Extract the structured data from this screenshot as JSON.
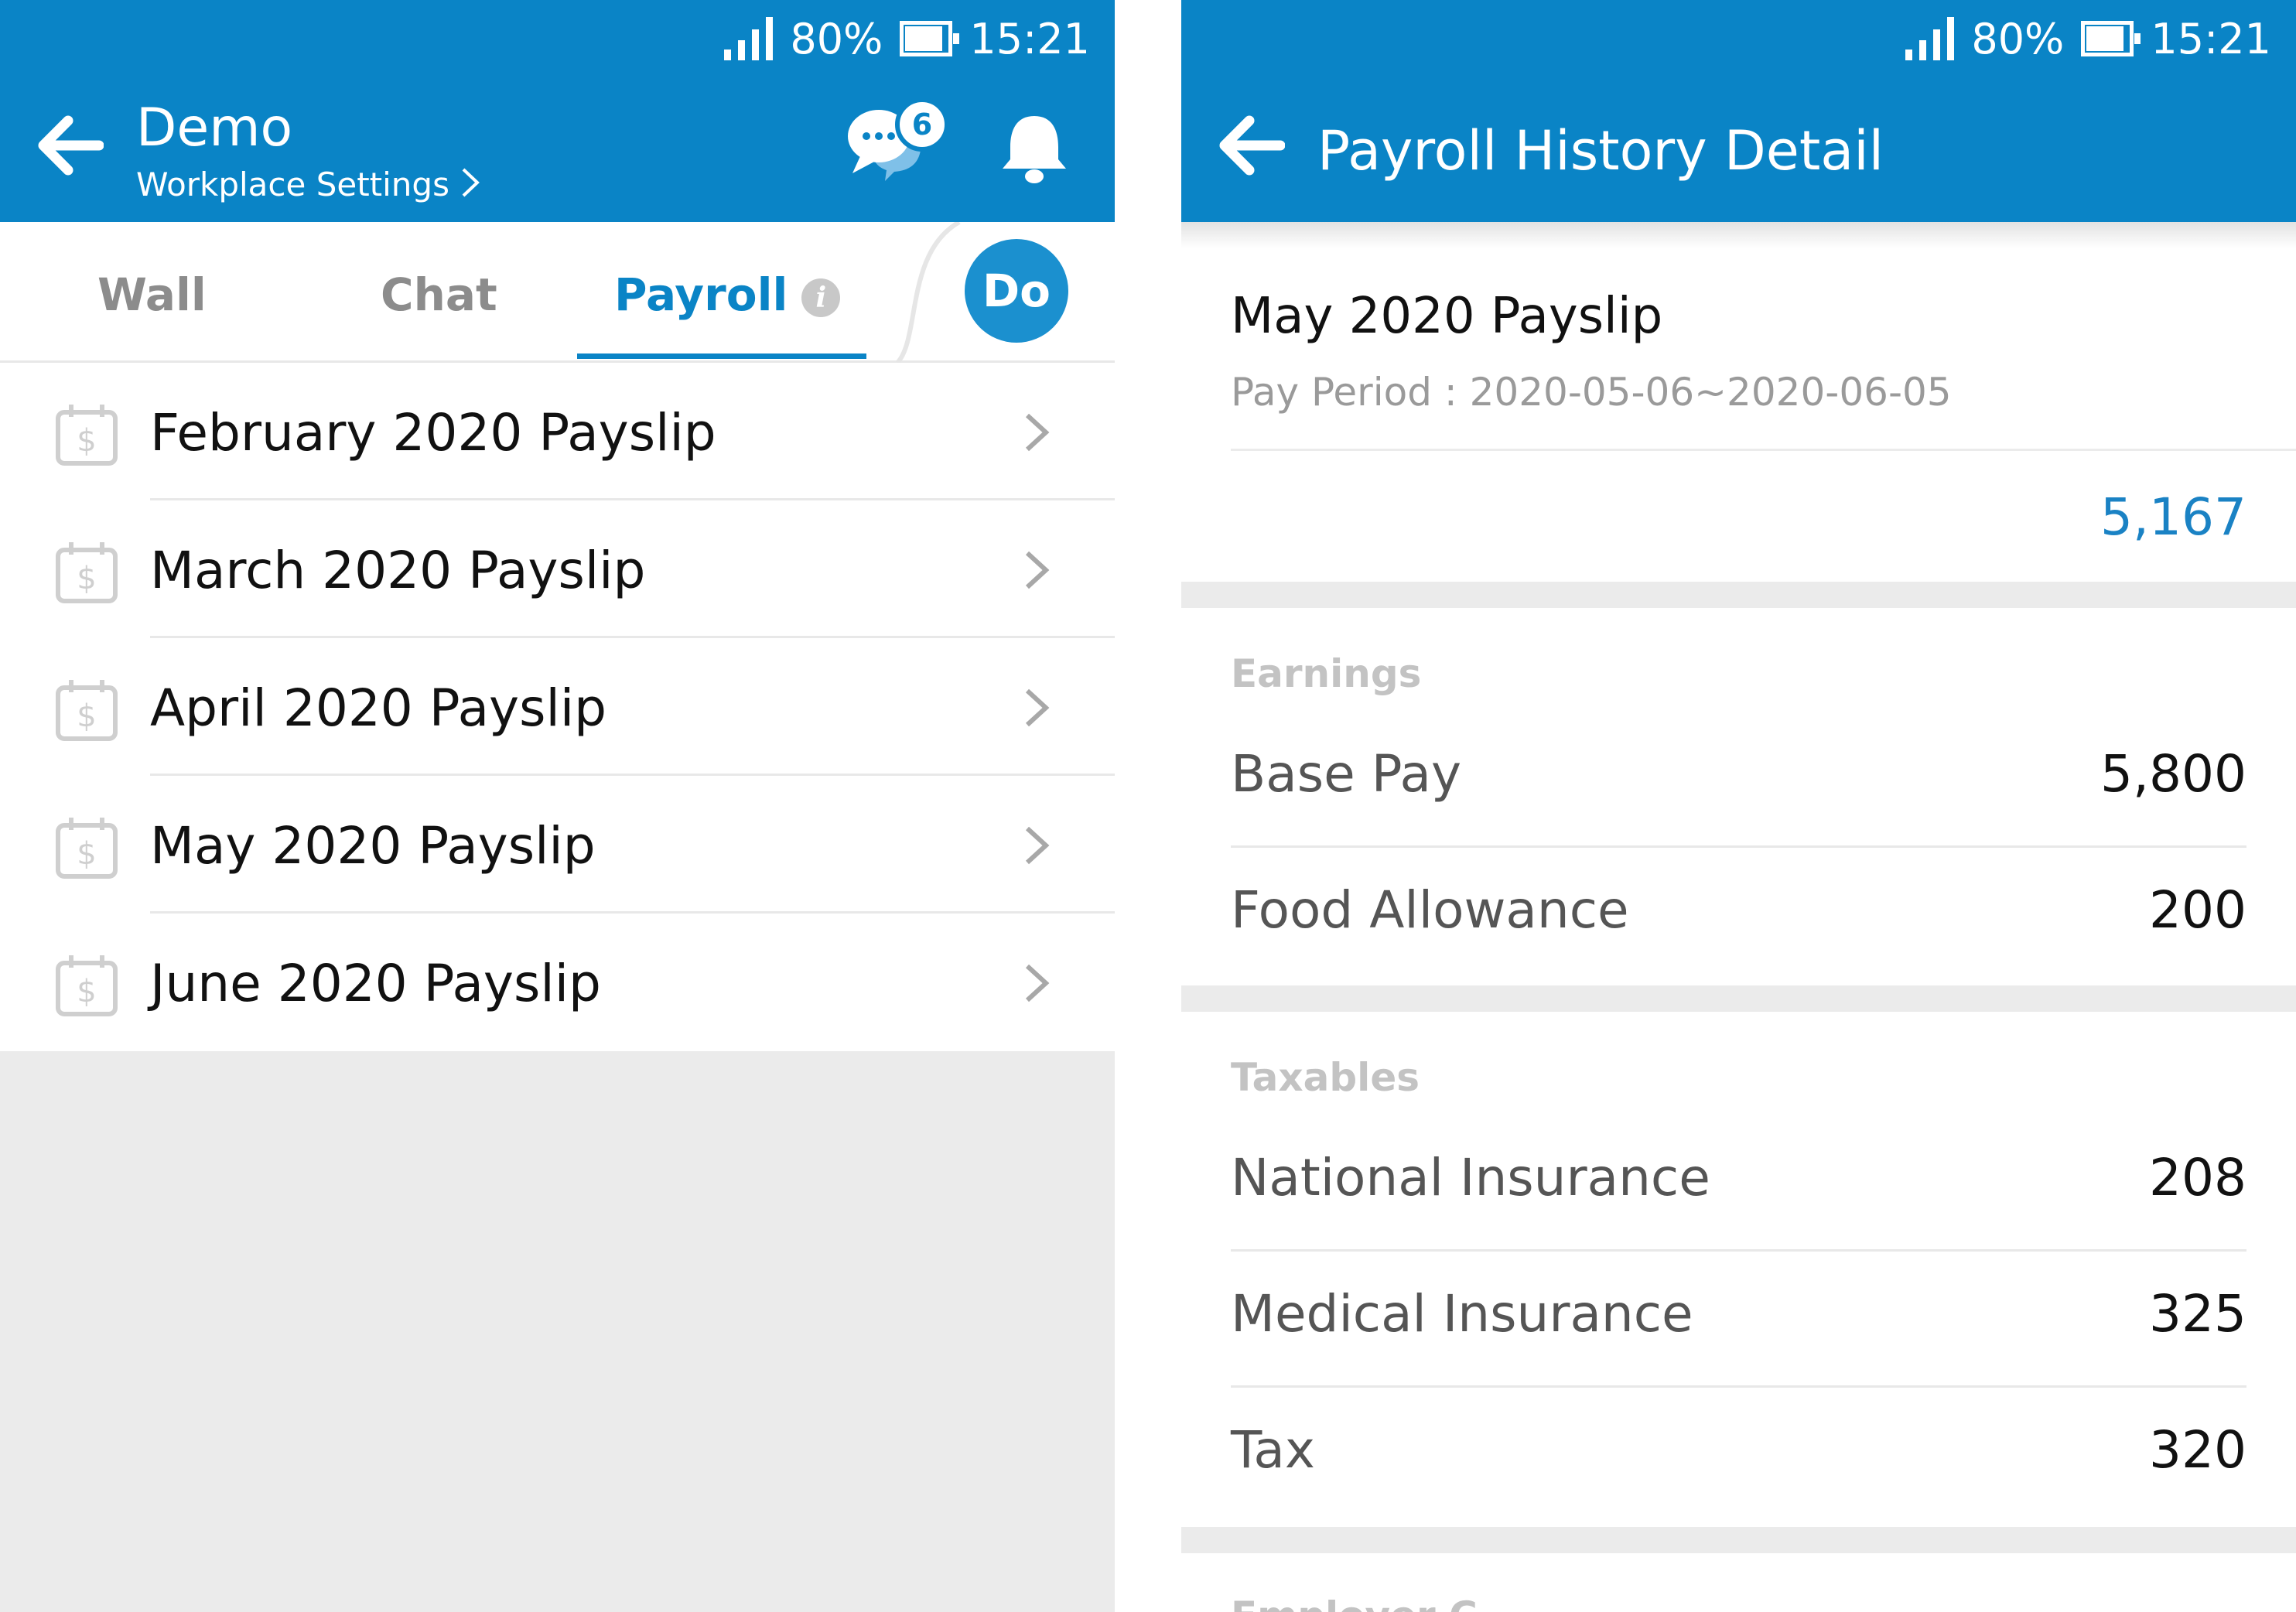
{
  "left": {
    "status": {
      "battery": "80%",
      "time": "15:21"
    },
    "header": {
      "title": "Demo",
      "subtitle": "Workplace Settings",
      "chat_badge": "6"
    },
    "tabs": [
      {
        "label": "Wall",
        "active": false
      },
      {
        "label": "Chat",
        "active": false
      },
      {
        "label": "Payroll",
        "active": true
      }
    ],
    "info_glyph": "i",
    "avatar": "Do",
    "payslips": [
      {
        "label": "February 2020 Payslip"
      },
      {
        "label": "March 2020 Payslip"
      },
      {
        "label": "April 2020 Payslip"
      },
      {
        "label": "May 2020 Payslip"
      },
      {
        "label": "June 2020 Payslip"
      }
    ]
  },
  "right": {
    "status": {
      "battery": "80%",
      "time": "15:21"
    },
    "header": {
      "title": "Payroll History Detail"
    },
    "slip": {
      "title": "May 2020 Payslip",
      "period": "Pay Period : 2020-05-06~2020-06-05",
      "net": "5,167"
    },
    "earnings": {
      "heading": "Earnings",
      "items": [
        {
          "label": "Base Pay",
          "value": "5,800"
        },
        {
          "label": "Food Allowance",
          "value": "200"
        }
      ]
    },
    "taxables": {
      "heading": "Taxables",
      "items": [
        {
          "label": "National Insurance",
          "value": "208"
        },
        {
          "label": "Medical Insurance",
          "value": "325"
        },
        {
          "label": "Tax",
          "value": "320"
        }
      ]
    },
    "next_section_partial": "Employer C"
  },
  "colors": {
    "primary": "#0a84c6",
    "net_amount": "#1a82c4",
    "muted": "#9a9a9a",
    "section_heading": "#c3c3c3"
  },
  "icons": [
    "back-arrow-icon",
    "chat-bubbles-icon",
    "bell-icon",
    "info-icon",
    "payslip-calendar-icon",
    "chevron-right-icon",
    "signal-icon",
    "battery-icon"
  ]
}
